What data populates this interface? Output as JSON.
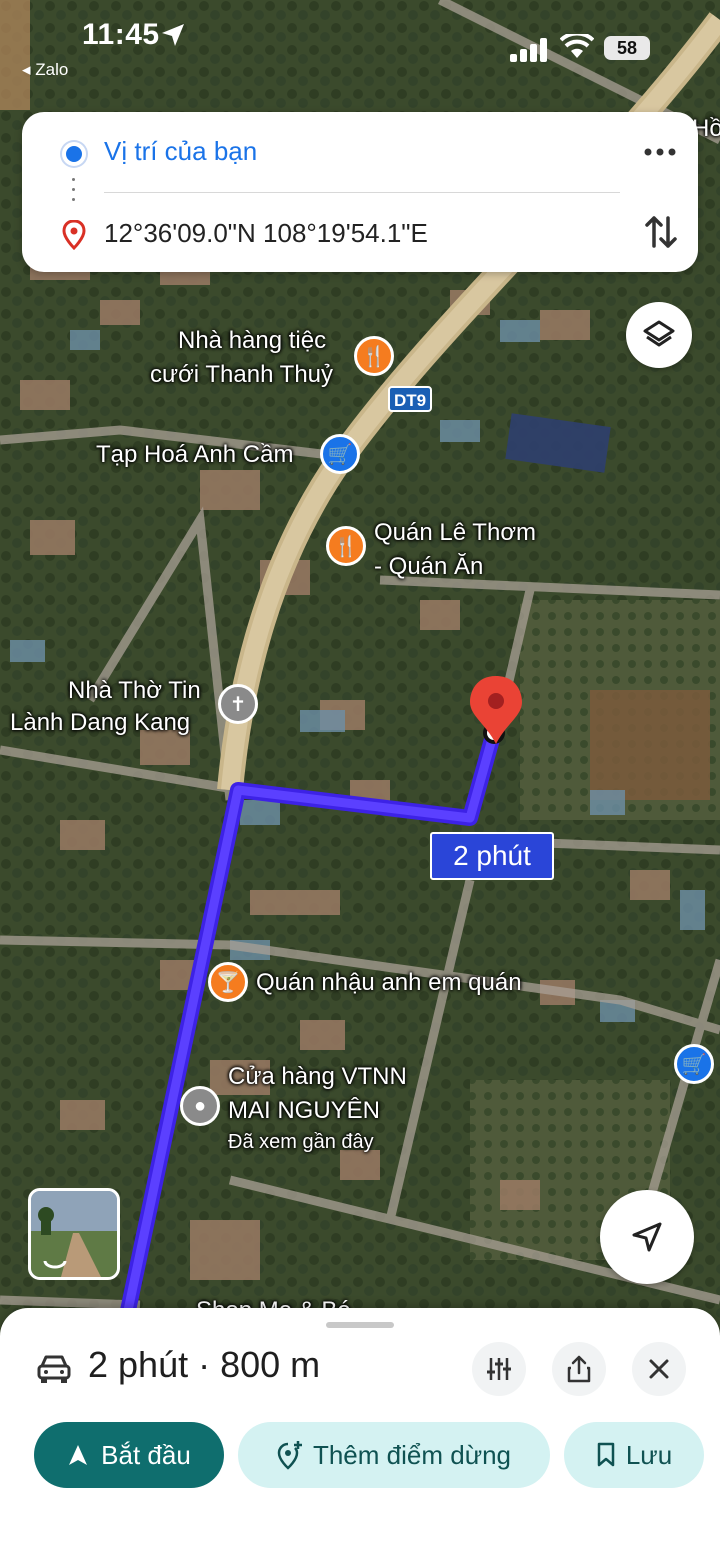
{
  "status_bar": {
    "time": "11:45",
    "back_app": "◂ Zalo",
    "battery": "58"
  },
  "directions": {
    "origin": "Vị trí của bạn",
    "destination": "12°36'09.0\"N 108°19'54.1\"E"
  },
  "map": {
    "road_badge": "DT9",
    "duration_label": "2 phút",
    "pois": {
      "restaurant_1_line1": "Nhà hàng tiệc",
      "restaurant_1_line2": "cưới Thanh Thuỷ",
      "grocery_1": "Tạp Hoá Anh Cầm",
      "restaurant_2_line1": "Quán Lê Thơm",
      "restaurant_2_line2": "- Quán Ăn",
      "church_line1": "Nhà Thờ Tin",
      "church_line2": "Lành Dang Kang",
      "bar_1": "Quán nhậu anh em quán",
      "store_line1": "Cửa hàng VTNN",
      "store_line2": "MAI NGUYÊN",
      "store_sub": "Đã xem gần đây",
      "partial_bottom": "Shop Mẹ & Bé",
      "partial_top_right": "Hồ"
    }
  },
  "sheet": {
    "summary": "2 phút · 800 m",
    "start_label": "Bắt đầu",
    "add_stop_label": "Thêm điểm dừng",
    "save_label": "Lưu"
  },
  "colors": {
    "route": "#3d22e6",
    "accent_blue": "#1a73e8",
    "start_button": "#0f6e6e",
    "chip_bg": "#d4f2f2",
    "pin_red": "#ea4335"
  }
}
